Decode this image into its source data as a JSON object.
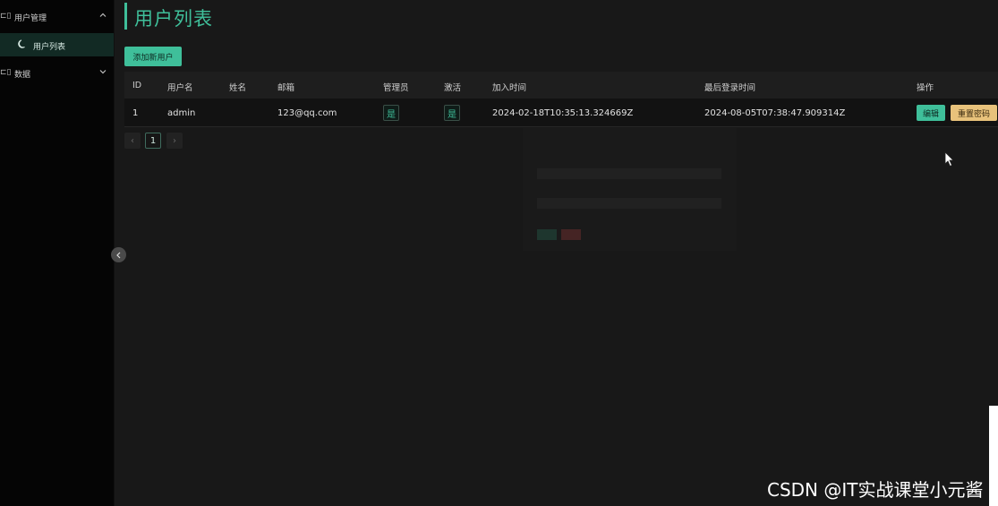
{
  "sidebar": {
    "groups": [
      {
        "label": "用户管理",
        "icon": "data-structure-icon",
        "expanded": true
      },
      {
        "label": "数据",
        "icon": "data-structure-icon",
        "expanded": false
      }
    ],
    "active_item": {
      "label": "用户列表",
      "icon": "moon-icon"
    },
    "group_icon_glyph": "⊏▯"
  },
  "page": {
    "title": "用户列表",
    "add_button": "添加新用户"
  },
  "table": {
    "columns": [
      "ID",
      "用户名",
      "姓名",
      "邮箱",
      "管理员",
      "激活",
      "加入时间",
      "最后登录时间",
      "操作"
    ],
    "rows": [
      {
        "id": "1",
        "username": "admin",
        "name": "",
        "email": "123@qq.com",
        "admin": "是",
        "active": "是",
        "joined": "2024-02-18T10:35:13.324669Z",
        "last_login": "2024-08-05T07:38:47.909314Z",
        "edit": "编辑",
        "reset": "重置密码"
      }
    ]
  },
  "pagination": {
    "current": "1",
    "prev": "‹",
    "next": "›"
  },
  "collapse_icon": "‹",
  "watermark": "CSDN @IT实战课堂小元酱",
  "colors": {
    "accent": "#3fbf9a",
    "warning": "#e8c27b",
    "sidebar_bg": "#050505",
    "main_bg": "#181818"
  }
}
